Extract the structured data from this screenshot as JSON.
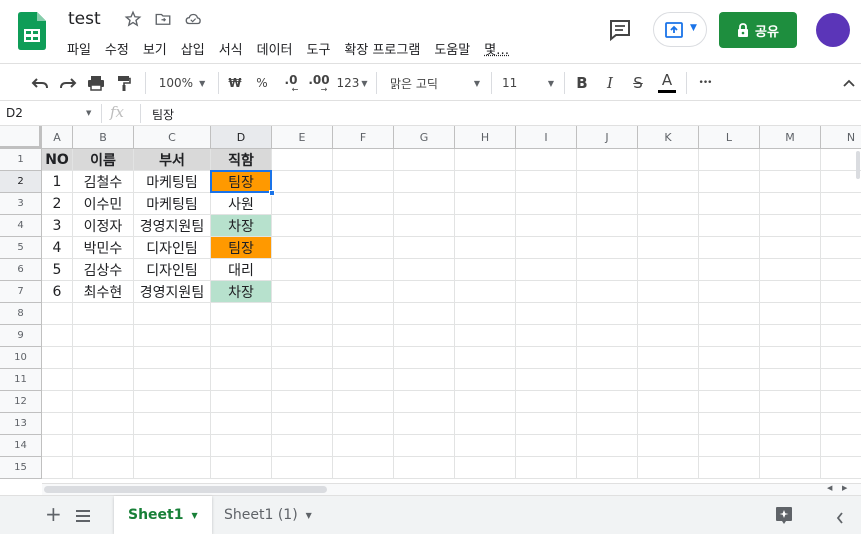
{
  "app": {
    "doc_title": "test",
    "menu": [
      "파일",
      "수정",
      "보기",
      "삽입",
      "서식",
      "데이터",
      "도구",
      "확장 프로그램",
      "도움말",
      "몇…"
    ],
    "share_label": "공유",
    "brand_color": "#188038",
    "share_color": "#1e8e3e",
    "avatar_color": "#5b35b8"
  },
  "toolbar": {
    "zoom": "100%",
    "currency": "₩",
    "percent": "%",
    "dec_decrease": ".0",
    "dec_increase": ".00",
    "number_format": "123",
    "font": "맑은 고딕",
    "font_size": "11",
    "bold": "B",
    "italic": "I",
    "strike": "S",
    "text_color": "A",
    "more": "•••"
  },
  "formula_bar": {
    "cell_ref": "D2",
    "fx": "fx",
    "content": "팀장"
  },
  "sheet": {
    "columns": [
      "A",
      "B",
      "C",
      "D",
      "E",
      "F",
      "G",
      "H",
      "I",
      "J",
      "K",
      "L",
      "M",
      "N"
    ],
    "rows": [
      "1",
      "2",
      "3",
      "4",
      "5",
      "6",
      "7",
      "8",
      "9",
      "10",
      "11",
      "12",
      "13",
      "14",
      "15"
    ],
    "selected_cell": "D2",
    "header_row": [
      "NO",
      "이름",
      "부서",
      "직함"
    ],
    "data_rows": [
      [
        "1",
        "김철수",
        "마케팅팀",
        "팀장"
      ],
      [
        "2",
        "이수민",
        "마케팅팀",
        "사원"
      ],
      [
        "3",
        "이정자",
        "경영지원팀",
        "차장"
      ],
      [
        "4",
        "박민수",
        "디자인팀",
        "팀장"
      ],
      [
        "5",
        "김상수",
        "디자인팀",
        "대리"
      ],
      [
        "6",
        "최수현",
        "경영지원팀",
        "차장"
      ]
    ],
    "fill_colors": {
      "header": "#d9d9d9",
      "팀장": "#ff9900",
      "차장": "#b7e1cd"
    }
  },
  "tabs": [
    {
      "label": "Sheet1",
      "active": true
    },
    {
      "label": "Sheet1 (1)",
      "active": false
    }
  ]
}
